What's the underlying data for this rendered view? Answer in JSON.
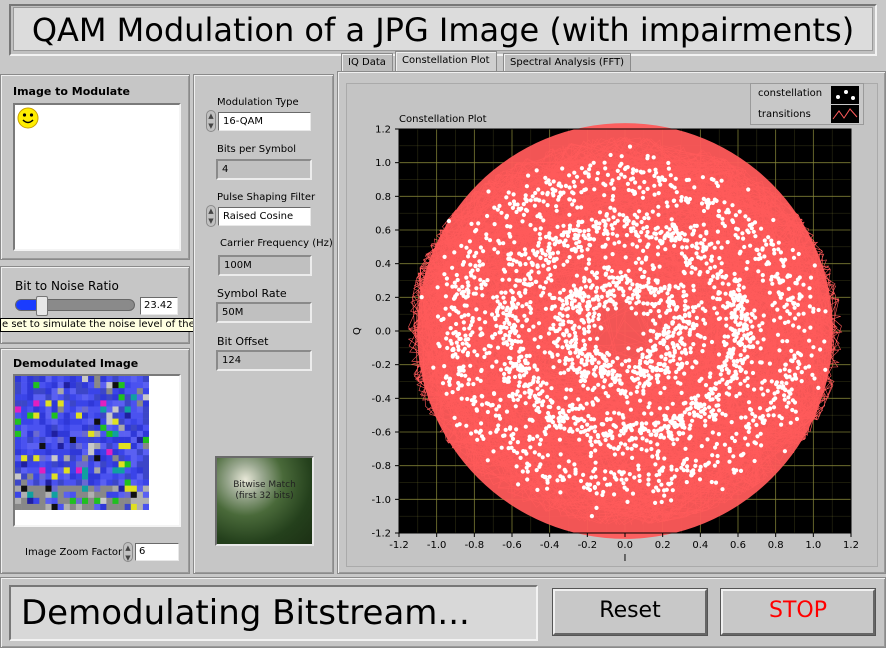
{
  "window": {
    "title": "QAM Modulation of a JPG Image (with impairments)"
  },
  "tabs": [
    {
      "label": "IQ Data",
      "active": false
    },
    {
      "label": "Constellation Plot",
      "active": true
    },
    {
      "label": "Spectral Analysis (FFT)",
      "active": false
    }
  ],
  "image_panel": {
    "label": "Image to Modulate",
    "icon": "smiley-icon"
  },
  "noise": {
    "label": "Bit to Noise Ratio",
    "value": "23.42",
    "level_fraction": 0.2,
    "tooltip": "e set to simulate the noise level of the physical channel"
  },
  "demod_panel": {
    "label": "Demodulated Image",
    "zoom_label": "Image Zoom Factor",
    "zoom_value": "6"
  },
  "params": {
    "mod_type_label": "Modulation Type",
    "mod_type_value": "16-QAM",
    "bits_label": "Bits per Symbol",
    "bits_value": "4",
    "pulse_label": "Pulse Shaping Filter",
    "pulse_value": "Raised Cosine",
    "carrier_label": "Carrier Frequency (Hz)",
    "carrier_value": "100M",
    "symrate_label": "Symbol Rate",
    "symrate_value": "50M",
    "bitoffset_label": "Bit Offset",
    "bitoffset_value": "124",
    "match_label_1": "Bitwise Match",
    "match_label_2": "(first 32 bits)"
  },
  "legend": {
    "constellation": "constellation",
    "transitions": "transitions"
  },
  "chart_data": {
    "type": "scatter",
    "title": "Constellation Plot",
    "xlabel": "I",
    "ylabel": "Q",
    "xlim": [
      -1.2,
      1.2
    ],
    "ylim": [
      -1.2,
      1.2
    ],
    "xticks": [
      "-1.2",
      "-1.0",
      "-0.8",
      "-0.6",
      "-0.4",
      "-0.2",
      "0.0",
      "0.2",
      "0.4",
      "0.6",
      "0.8",
      "1.0",
      "1.2"
    ],
    "yticks": [
      "1.2",
      "1.0",
      "0.8",
      "0.6",
      "0.4",
      "0.2",
      "0.0",
      "-0.2",
      "-0.4",
      "-0.6",
      "-0.8",
      "-1.0",
      "-1.2"
    ],
    "grid": true,
    "legend_position": "top-right",
    "series": [
      {
        "name": "constellation",
        "color": "#ffffff",
        "description_rings": [
          {
            "radius": 0.9,
            "spread": 0.12
          },
          {
            "radius": 0.62,
            "spread": 0.1
          },
          {
            "radius": 0.3,
            "spread": 0.12
          }
        ]
      },
      {
        "name": "transitions",
        "color": "#ff5a5a",
        "extent_radius": 1.15
      }
    ],
    "background": "#000000",
    "grid_color": "#8a8a3a"
  },
  "status": {
    "text": "Demodulating Bitstream..."
  },
  "buttons": {
    "reset": "Reset",
    "stop": "STOP",
    "stop_color": "#ff0000"
  }
}
